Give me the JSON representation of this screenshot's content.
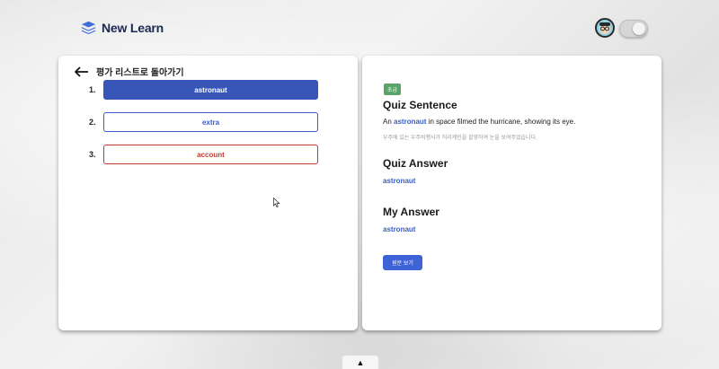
{
  "app": {
    "title": "New Learn"
  },
  "header": {
    "avatar": "avatar-icon",
    "toggle": "theme-toggle"
  },
  "left": {
    "back_label": "평가 리스트로 돌아가기",
    "items": [
      {
        "num": "1.",
        "word": "astronaut",
        "state": "selected"
      },
      {
        "num": "2.",
        "word": "extra",
        "state": "correct"
      },
      {
        "num": "3.",
        "word": "account",
        "state": "wrong"
      }
    ]
  },
  "right": {
    "badge": "초급",
    "quiz_sentence_title": "Quiz Sentence",
    "sentence_before": "An ",
    "sentence_highlight": "astronaut",
    "sentence_after": " in space filmed the hurricane, showing its eye.",
    "translation": "우주에 있는 우주비행사가 허리케인을 촬영하여 눈을 보여주었습니다.",
    "quiz_answer_title": "Quiz Answer",
    "quiz_answer": "astronaut",
    "my_answer_title": "My Answer",
    "my_answer": "astronaut",
    "view_original_label": "원문 보기"
  },
  "bottom_tab": "▲",
  "colors": {
    "primary": "#3756b8",
    "correct": "#3a5dc6",
    "wrong": "#c23a2f",
    "badge": "#5aa469"
  }
}
